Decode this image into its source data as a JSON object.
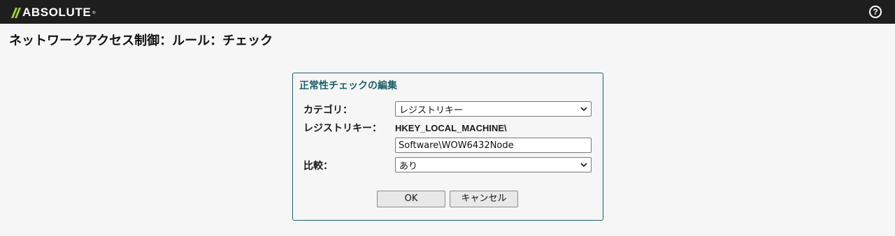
{
  "brand": {
    "name": "ABSOLUTE",
    "reg": "®",
    "accent": "#9ed23c"
  },
  "header": {
    "help_icon": "question-circle-icon",
    "help_glyph": "?"
  },
  "page": {
    "title": "ネットワークアクセス制御：ルール：チェック"
  },
  "panel": {
    "title": "正常性チェックの編集",
    "category_label": "カテゴリ：",
    "category_value": "レジストリキー",
    "registry_label": "レジストリキー：",
    "registry_hive": "HKEY_LOCAL_MACHINE\\",
    "registry_path": "Software\\WOW6432Node",
    "compare_label": "比較：",
    "compare_value": "あり",
    "ok_label": "OK",
    "cancel_label": "キャンセル",
    "accent_color": "#1f5f6a"
  }
}
